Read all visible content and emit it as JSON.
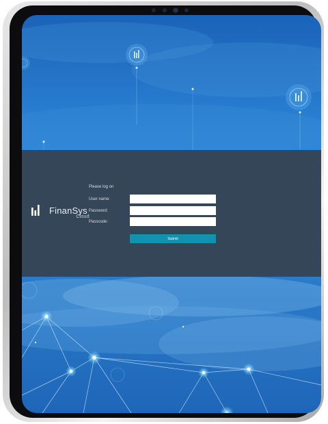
{
  "brand": {
    "name": "FinanSys",
    "sub": "Cloud",
    "accent": "#1292b3",
    "band_color": "#364659"
  },
  "login": {
    "prompt": "Please log on",
    "fields": [
      {
        "label": "User name:",
        "value": ""
      },
      {
        "label": "Password:",
        "value": ""
      },
      {
        "label": "Passcode:",
        "value": ""
      }
    ],
    "submit_label": "Submit"
  },
  "icons": [
    "bar-chart-logo-icon",
    "bar-chart-node-icon",
    "front-camera-icon"
  ]
}
